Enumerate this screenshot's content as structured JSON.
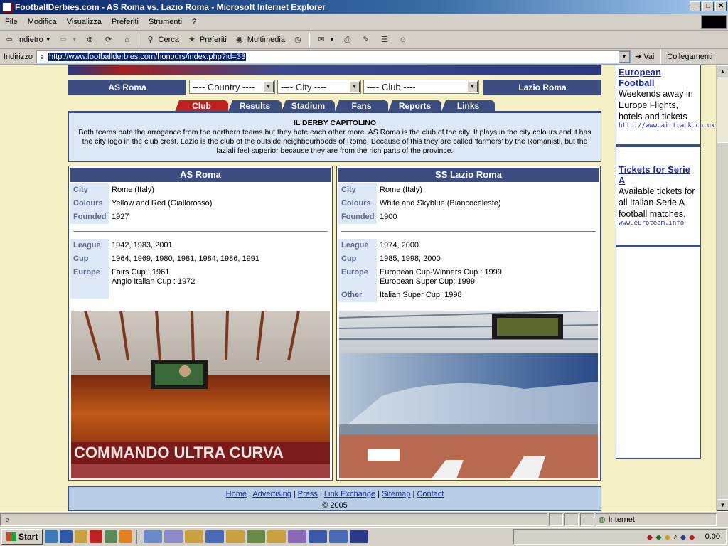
{
  "window": {
    "title": "FootballDerbies.com - AS Roma vs. Lazio Roma - Microsoft Internet Explorer",
    "buttons": [
      "_",
      "□",
      "✕"
    ]
  },
  "menu": [
    "File",
    "Modifica",
    "Visualizza",
    "Preferiti",
    "Strumenti",
    "?"
  ],
  "toolbar": {
    "back": "Indietro",
    "search": "Cerca",
    "favorites": "Preferiti",
    "media": "Multimedia"
  },
  "address": {
    "label": "Indirizzo",
    "url": "http://www.footballderbies.com/honours/index.php?id=33",
    "go": "Vai",
    "links": "Collegamenti"
  },
  "site": {
    "team_left": "AS Roma",
    "team_right": "Lazio Roma",
    "selects": {
      "country": "---- Country ----",
      "city": "---- City ----",
      "club": "---- Club ----"
    },
    "tabs": [
      "Club",
      "Results",
      "Stadium",
      "Fans",
      "Reports",
      "Links"
    ],
    "intro_title": "IL DERBY CAPITOLINO",
    "intro_text": "Both teams hate the arrogance from the northern teams but they hate each other more. AS Roma is the club of the city. It plays in the city colours and it has the city logo in the club crest. Lazio is the club of the outside neighbourhoods of Rome. Because of this they are called 'farmers' by the Romanisti, but the laziali feel superior because they are from the rich parts of the province.",
    "left_panel": {
      "name": "AS Roma",
      "city_label": "City",
      "city": "Rome (Italy)",
      "colours_label": "Colours",
      "colours": "Yellow and Red (Giallorosso)",
      "founded_label": "Founded",
      "founded": "1927",
      "league_label": "League",
      "league": "1942, 1983, 2001",
      "cup_label": "Cup",
      "cup": "1964, 1969, 1980, 1981, 1984, 1986, 1991",
      "europe_label": "Europe",
      "europe_1": "Fairs Cup : 1961",
      "europe_2": "Anglo Italian Cup : 1972"
    },
    "right_panel": {
      "name": "SS Lazio Roma",
      "city_label": "City",
      "city": "Rome (Italy)",
      "colours_label": "Colours",
      "colours": "White and Skyblue (Biancoceleste)",
      "founded_label": "Founded",
      "founded": "1900",
      "league_label": "League",
      "league": "1974, 2000",
      "cup_label": "Cup",
      "cup": "1985, 1998, 2000",
      "europe_label": "Europe",
      "europe_1": "European Cup-Winners Cup : 1999",
      "europe_2": "European Super Cup: 1999",
      "other_label": "Other",
      "other": "Italian Super Cup: 1998"
    },
    "photo_left_banner": "COMMANDO ULTRA CURVA",
    "footer": {
      "links": [
        "Home",
        "Advertising",
        "Press",
        "Link Exchange",
        "Sitemap",
        "Contact"
      ],
      "copyright": "© 2005"
    },
    "ads": [
      {
        "title": "European Football",
        "desc": "Weekends away in Europe Flights, hotels and tickets",
        "url": "http://www.airtrack.co.uk"
      },
      {
        "title": "Tickets for Serie A",
        "desc": "Available tickets for all Italian Serie A football matches.",
        "url": "www.euroteam.info"
      }
    ]
  },
  "status": {
    "zone": "Internet"
  },
  "taskbar": {
    "start": "Start",
    "clock": "0.00"
  }
}
